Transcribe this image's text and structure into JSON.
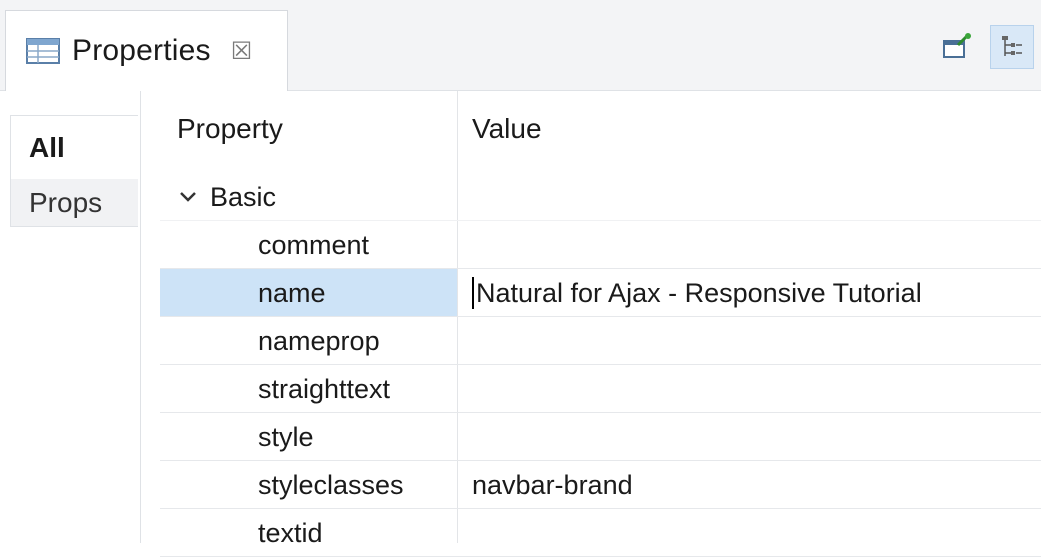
{
  "view": {
    "title": "Properties",
    "close_glyph": "☒"
  },
  "toolbar": {
    "pin_icon": "pin-icon",
    "tree_icon": "tree-view-icon"
  },
  "categories": [
    {
      "label": "All",
      "active": true
    },
    {
      "label": "Props",
      "active": false
    }
  ],
  "table": {
    "header_property": "Property",
    "header_value": "Value",
    "group": {
      "label": "Basic",
      "expanded": true
    },
    "rows": [
      {
        "name": "comment",
        "value": ""
      },
      {
        "name": "name",
        "value": "Natural for Ajax - Responsive Tutorial",
        "selected": true
      },
      {
        "name": "nameprop",
        "value": ""
      },
      {
        "name": "straighttext",
        "value": ""
      },
      {
        "name": "style",
        "value": ""
      },
      {
        "name": "styleclasses",
        "value": "navbar-brand"
      },
      {
        "name": "textid",
        "value": ""
      }
    ]
  },
  "colors": {
    "selection": "#cde3f7",
    "tool_active": "#d9e8f7"
  }
}
